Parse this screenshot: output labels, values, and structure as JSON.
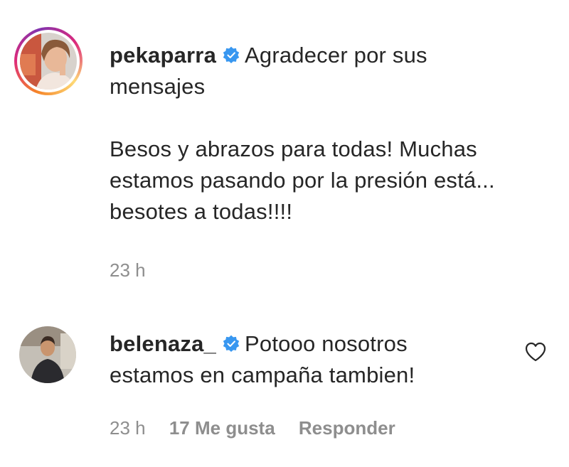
{
  "comments": [
    {
      "username": "pekaparra",
      "verified": true,
      "text_line1": "Agradecer por sus",
      "text_line2": "mensajes",
      "text_line3": "Besos y abrazos para todas! Muchas",
      "text_line4": "estamos pasando por la presión está...",
      "text_line5": "besotes a todas!!!!",
      "time": "23 h"
    },
    {
      "username": "belenaza_",
      "verified": true,
      "text_line1": "Potooo nosotros",
      "text_line2": "estamos en campaña tambien!",
      "time": "23 h",
      "likes": "17 Me gusta",
      "reply_label": "Responder"
    }
  ],
  "colors": {
    "text": "#262626",
    "meta": "#8e8e8e",
    "verified_badge": "#3897f0"
  },
  "icons": {
    "verified": "verified-badge-icon",
    "like": "heart-outline-icon"
  }
}
